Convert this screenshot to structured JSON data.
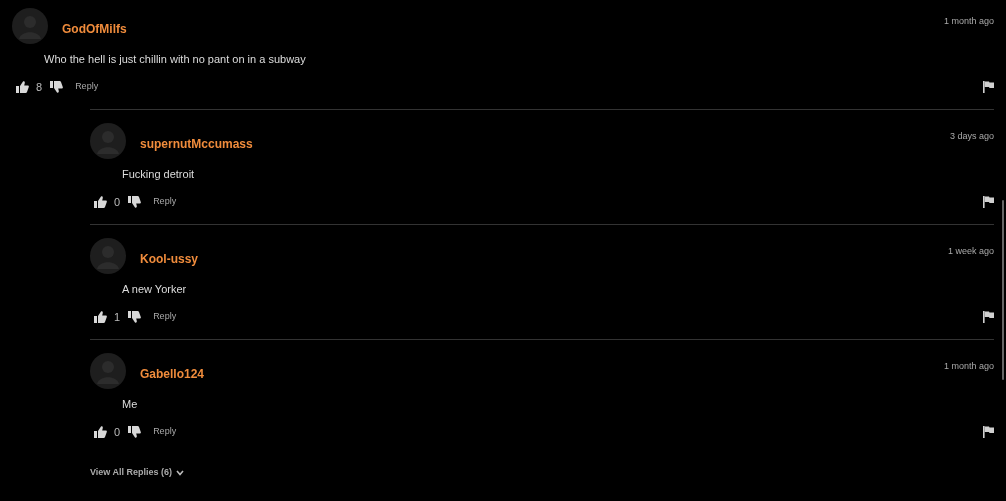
{
  "comment": {
    "author": "GodOfMilfs",
    "time": "1 month ago",
    "text": "Who the hell is just chillin with no pant on in a subway",
    "likes": "8",
    "reply_label": "Reply"
  },
  "replies": [
    {
      "author": "supernutMccumass",
      "time": "3 days ago",
      "text": "Fucking detroit",
      "likes": "0",
      "reply_label": "Reply"
    },
    {
      "author": "Kool-ussy",
      "time": "1 week ago",
      "text": "A new Yorker",
      "likes": "1",
      "reply_label": "Reply"
    },
    {
      "author": "Gabello124",
      "time": "1 month ago",
      "text": "Me",
      "likes": "0",
      "reply_label": "Reply"
    }
  ],
  "view_all_replies": "View All Replies (6)"
}
